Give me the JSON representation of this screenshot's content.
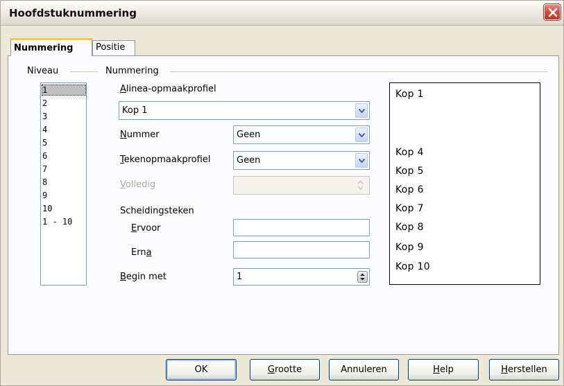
{
  "window": {
    "title": "Hoofdstuknummering"
  },
  "tabs": [
    {
      "label": "Nummering"
    },
    {
      "label": "Positie"
    }
  ],
  "groups": {
    "level_title": "Niveau",
    "numbering_title": "Nummering"
  },
  "levels": [
    "1",
    "2",
    "3",
    "4",
    "5",
    "6",
    "7",
    "8",
    "9",
    "10",
    "1 - 10"
  ],
  "selected_level": "1",
  "fields": {
    "paragraph_style": {
      "label": "Alinea-opmaakprofiel",
      "value": "Kop 1"
    },
    "number": {
      "label": "Nummer",
      "value": "Geen"
    },
    "char_style": {
      "label": "Tekenopmaakprofiel",
      "value": "Geen"
    },
    "complete": {
      "label": "Volledig",
      "value": ""
    },
    "separator": {
      "label": "Scheidingsteken"
    },
    "before": {
      "label": "Ervoor",
      "value": ""
    },
    "after": {
      "label": "Erna",
      "value": ""
    },
    "start_at": {
      "label": "Begin met",
      "value": "1"
    }
  },
  "preview": [
    "Kop 1",
    "Kop 4",
    "Kop 5",
    "Kop 6",
    "Kop 7",
    "Kop 8",
    "Kop 9",
    "Kop 10"
  ],
  "buttons": {
    "ok": "OK",
    "size": "Grootte",
    "cancel": "Annuleren",
    "help": "Help",
    "reset": "Herstellen"
  }
}
